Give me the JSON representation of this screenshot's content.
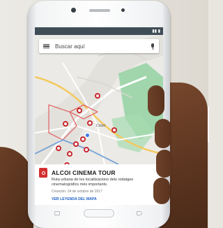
{
  "search": {
    "placeholder": "Buscar aquí"
  },
  "card": {
    "title": "ALCOI CINEMA TOUR",
    "description": "Ruta urbana de les localitzacions dels rodatges cinematogràfics més importants.",
    "date": "Creación: 24 de octubre de 2017",
    "cta": "VER LEYENDA DEL MAPA"
  },
  "map": {
    "place_label": "Ciutat"
  },
  "colors": {
    "accent": "#c7262c",
    "link": "#1e60c8",
    "park": "#8fd19e",
    "route": "#e06a6a"
  }
}
